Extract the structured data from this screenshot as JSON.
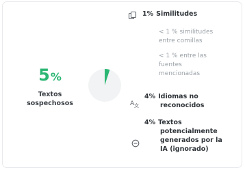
{
  "summary": {
    "value": "5",
    "unit": "%",
    "label_line1": "Textos",
    "label_line2": "sospechosos",
    "level_percent": 5,
    "accent_color": "#2bb673"
  },
  "items": [
    {
      "icon": "copy-icon",
      "percent": "1%",
      "title": "Similitudes"
    },
    {
      "icon": "translate-icon",
      "percent": "4%",
      "title_line1": "Idiomas no",
      "title_line2": "reconocidos"
    },
    {
      "icon": "robot-icon",
      "percent": "4%",
      "title_line1": "Textos",
      "title_line2": "potencialmente",
      "title_line3": "generados por la",
      "title_line4": "IA (ignorado)"
    }
  ],
  "sub_items": [
    {
      "percent": "< 1 %",
      "line1": "similitudes",
      "line2": "entre comillas"
    },
    {
      "percent": "< 1 %",
      "line1": "entre las",
      "line2": "fuentes",
      "line3": "mencionadas"
    }
  ]
}
